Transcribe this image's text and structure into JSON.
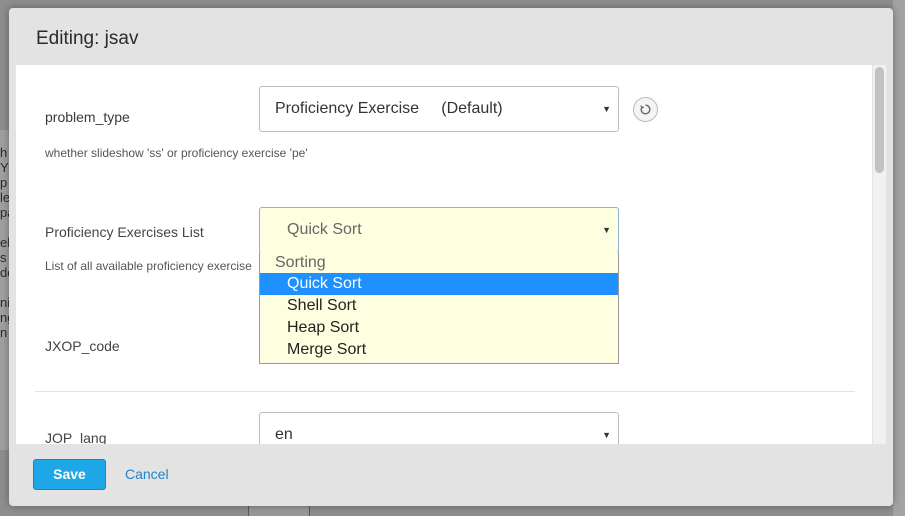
{
  "background": {
    "letters": [
      "h",
      "Y",
      "p",
      "le",
      "pa",
      "",
      "ele",
      "s",
      "de",
      "",
      "nin",
      "ng",
      "n"
    ]
  },
  "modal": {
    "title": "Editing: jsav"
  },
  "fields": {
    "problem_type": {
      "label": "problem_type",
      "value": "Proficiency Exercise     (Default)",
      "help": "whether slideshow 'ss' or proficiency exercise 'pe'"
    },
    "pe_list": {
      "label": "Proficiency Exercises List",
      "value": "Quick Sort",
      "help": "List of all available proficiency exercise"
    },
    "jxop_code": {
      "label": "JXOP_code"
    },
    "jop_lang": {
      "label": "JOP_lang",
      "value": "en"
    }
  },
  "dropdown": {
    "group_label": "Sorting",
    "options": [
      "Quick Sort",
      "Shell Sort",
      "Heap Sort",
      "Merge Sort"
    ],
    "selected_index": 0
  },
  "footer": {
    "save_label": "Save",
    "cancel_label": "Cancel"
  },
  "colors": {
    "accent": "#1ea7e6",
    "link": "#1f83c8",
    "selected_option": "#1e90ff",
    "open_select_bg": "#fefee0"
  }
}
